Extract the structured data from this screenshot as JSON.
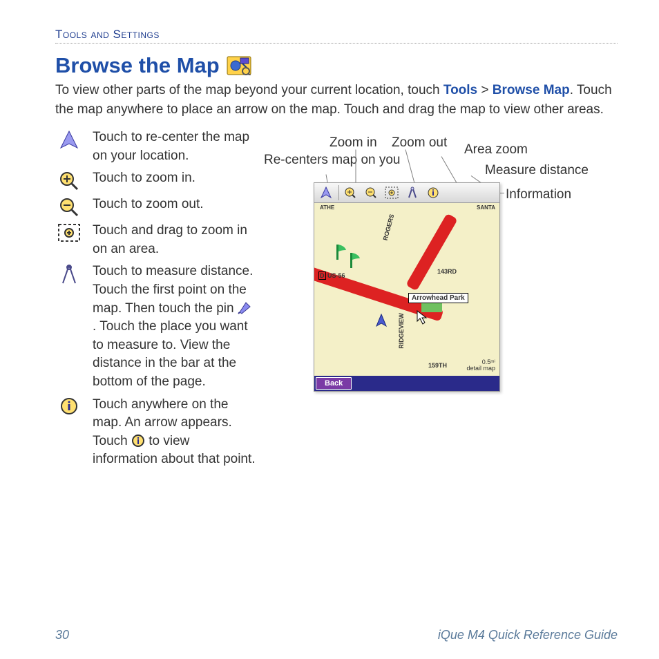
{
  "header": {
    "section": "Tools and Settings"
  },
  "title": "Browse the Map",
  "intro": {
    "pre": "To view other parts of the map beyond your current location, touch ",
    "tools": "Tools",
    "gt": " > ",
    "browse": "Browse Map",
    "post": ". Touch the map anywhere to place an arrow on the map. Touch and drag the map to view other areas."
  },
  "items": [
    {
      "text": "Touch to re-center the map on your location."
    },
    {
      "text": "Touch to zoom in."
    },
    {
      "text": "Touch to zoom out."
    },
    {
      "text": "Touch and drag to zoom in on an area."
    },
    {
      "textA": "Touch to measure distance. Touch the first point on the map. Then touch the pin ",
      "textB": ". Touch the place you want to measure to. View the distance in the bar at the bottom of the page."
    },
    {
      "textA": "Touch anywhere on the map. An arrow appears. Touch ",
      "textB": " to view information about that point."
    }
  ],
  "callouts": {
    "recenter": "Re-centers map on you",
    "zoomin": "Zoom in",
    "zoomout": "Zoom out",
    "areazoom": "Area zoom",
    "measure": "Measure distance",
    "info": "Information"
  },
  "map": {
    "roads": {
      "rogers": "ROGERS",
      "us56": "US-56",
      "143rd": "143RD",
      "ridgeview": "RIDGEVIEW",
      "159th": "159TH",
      "santa": "SANTA",
      "olathe": "ATHE"
    },
    "tooltip": "Arrowhead Park",
    "back": "Back",
    "scale1": "0.5ᵐⁱ",
    "scale2": "detail map"
  },
  "footer": {
    "page": "30",
    "guide": "iQue M4 Quick Reference Guide"
  }
}
